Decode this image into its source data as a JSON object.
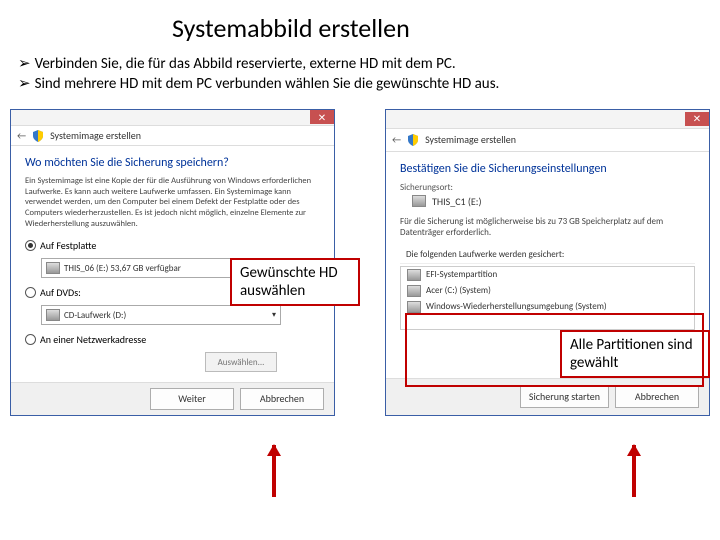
{
  "slide": {
    "title": "Systemabbild erstellen",
    "bullets": [
      "Verbinden Sie, die für das Abbild reservierte, externe HD mit dem PC.",
      "Sind mehrere HD mit dem PC verbunden wählen Sie die gewünschte HD aus."
    ]
  },
  "callout_a": "Gewünschte HD auswählen",
  "callout_b": "Alle Partitionen sind gewählt",
  "dialog_left": {
    "crumb": "Systemimage erstellen",
    "question": "Wo möchten Sie die Sicherung speichern?",
    "desc": "Ein Systemimage ist eine Kopie der für die Ausführung von Windows erforderlichen Laufwerke. Es kann auch weitere Laufwerke umfassen. Ein Systemimage kann verwendet werden, um den Computer bei einem Defekt der Festplatte oder des Computers wiederherzustellen. Es ist jedoch nicht möglich, einzelne Elemente zur Wiederherstellung auszuwählen.",
    "radio1": "Auf Festplatte",
    "dd1": "THIS_06 (E:) 53,67 GB verfügbar",
    "radio2": "Auf DVDs:",
    "dd2": "CD-Laufwerk (D:)",
    "radio3": "An einer Netzwerkadresse",
    "aux": "Auswählen...",
    "next": "Weiter",
    "cancel": "Abbrechen"
  },
  "dialog_right": {
    "crumb": "Systemimage erstellen",
    "question": "Bestätigen Sie die Sicherungseinstellungen",
    "target_label": "Sicherungsort:",
    "target_value": "THIS_C1 (E:)",
    "info": "Für die Sicherung ist möglicherweise bis zu 73 GB Speicherplatz auf dem Datenträger erforderlich.",
    "part_head": "Die folgenden Laufwerke werden gesichert:",
    "partitions": [
      "EFI-Systempartition",
      "Acer (C:) (System)",
      "Windows-Wiederherstellungsumgebung (System)"
    ],
    "start": "Sicherung starten",
    "cancel": "Abbrechen"
  }
}
